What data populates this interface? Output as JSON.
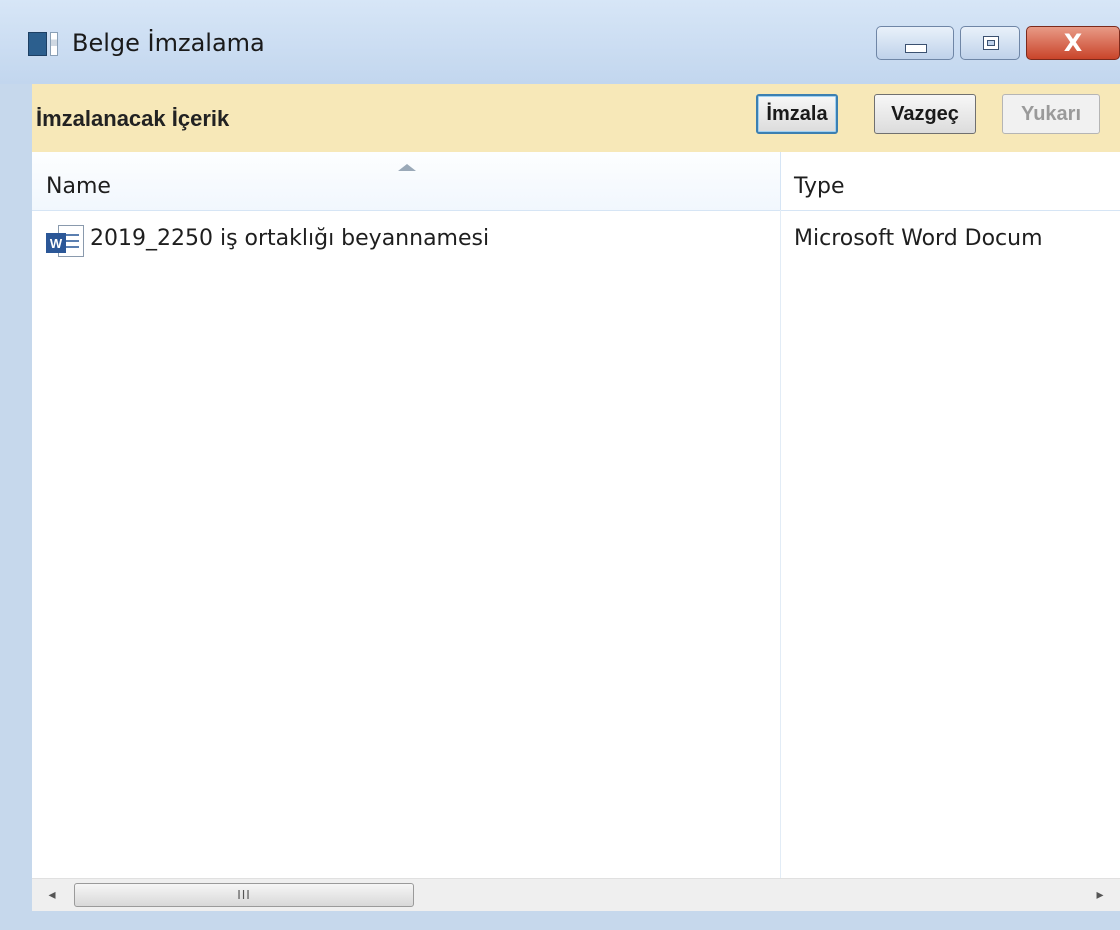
{
  "window": {
    "title": "Belge İmzalama",
    "icon": "app-window-icon",
    "controls": {
      "minimize": "minimize-icon",
      "maximize": "maximize-icon",
      "close_glyph": "X"
    }
  },
  "toolbar": {
    "title": "İmzalanacak İçerik",
    "sign_label": "İmzala",
    "cancel_label": "Vazgeç",
    "up_label": "Yukarı"
  },
  "list": {
    "columns": [
      "Name",
      "Type"
    ],
    "sort_column": "Name",
    "rows": [
      {
        "name": "2019_2250 iş ortaklığı beyannamesi",
        "type": "Microsoft Word Docum",
        "icon": "word-document-icon"
      }
    ]
  },
  "scrollbar": {
    "left_arrow": "◂",
    "right_arrow": "▸",
    "grip": "III"
  },
  "colors": {
    "toolbar_bg": "#f7e8b8",
    "window_frame": "#c6d8ec",
    "close_button": "#c9442a"
  }
}
